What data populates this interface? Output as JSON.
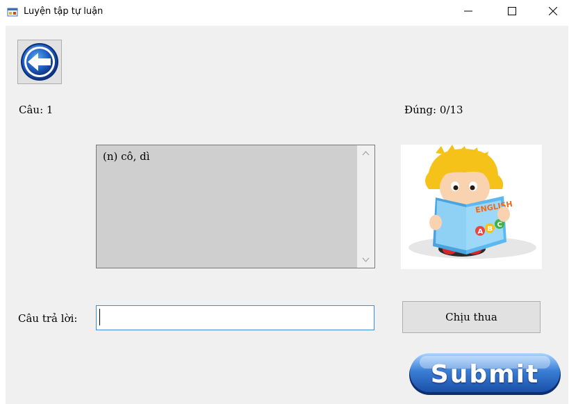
{
  "window": {
    "title": "Luyện tập tự luận",
    "minimize_glyph": "—",
    "maximize_glyph": "☐",
    "close_glyph": "✕"
  },
  "quiz": {
    "question_label": "Câu: 1",
    "score_label": "Đúng: 0/13",
    "question_text": "(n) cô, dì",
    "answer_label": "Câu trả lời:",
    "answer_value": "",
    "give_up_label": "Chịu thua",
    "submit_label": "Submit"
  },
  "illustration": {
    "book_text": "ENGLISH",
    "letters": [
      "A",
      "B",
      "C"
    ]
  },
  "icons": {
    "back": "back-arrow-icon",
    "app": "app-form-icon",
    "picture": "child-reading-english-book-image"
  },
  "colors": {
    "client_bg": "#f0f0f0",
    "question_bg": "#cfcfcf",
    "input_border": "#3c8ddb",
    "submit_blue": "#3b7fd6"
  }
}
